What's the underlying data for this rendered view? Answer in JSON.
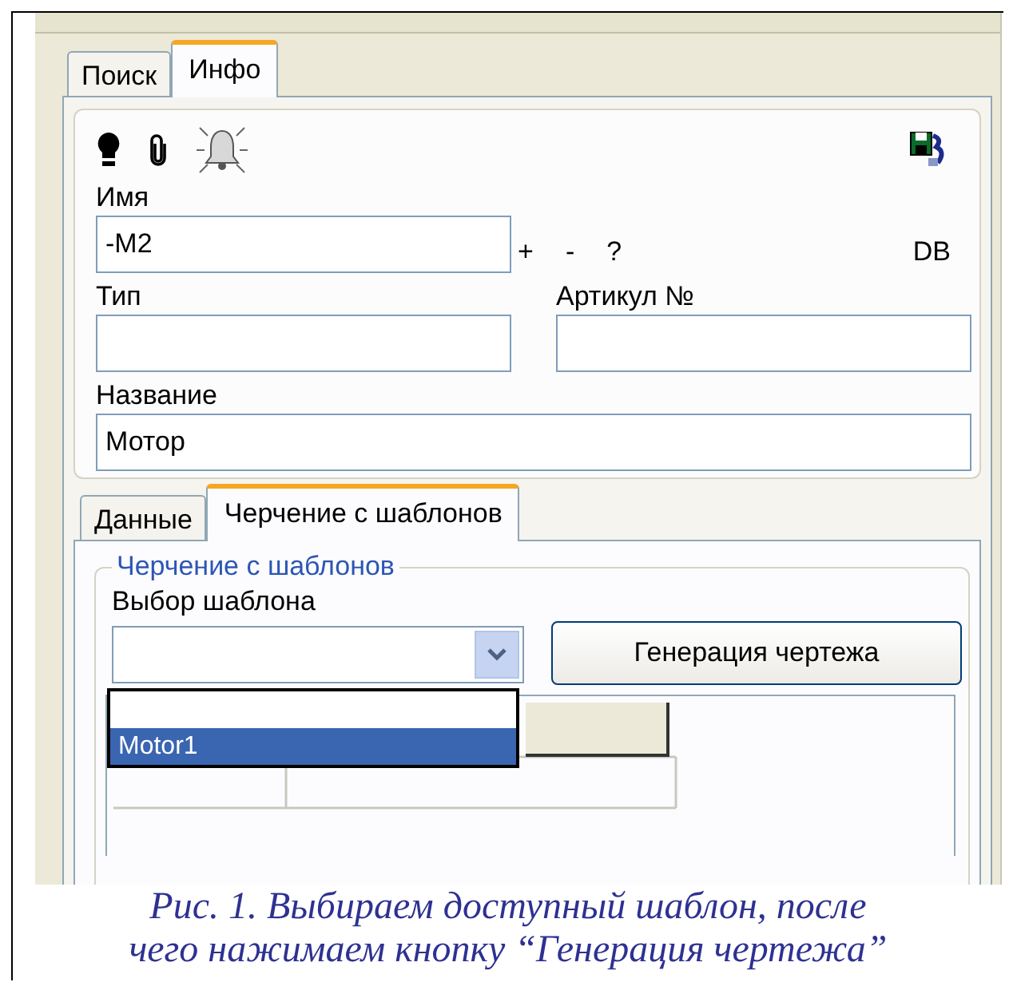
{
  "top_tabs": [
    {
      "label": "Поиск",
      "selected": false
    },
    {
      "label": "Инфо",
      "selected": true
    }
  ],
  "info": {
    "name_label": "Имя",
    "name_value": "-M2",
    "name_actions": [
      "+",
      "-",
      "?"
    ],
    "db_button": "DB",
    "type_label": "Тип",
    "article_label": "Артикул №",
    "title_label": "Название",
    "title_value": "Мотор"
  },
  "sub_tabs": [
    {
      "label": "Данные",
      "selected": false
    },
    {
      "label": "Черчение с шаблонов",
      "selected": true
    }
  ],
  "template_group": {
    "title": "Черчение с шаблонов",
    "select_label": "Выбор шаблона",
    "generate_button": "Генерация чертежа",
    "dropdown_blank_row": true,
    "dropdown": [
      {
        "label": "Motor1",
        "selected": true
      }
    ]
  },
  "caption": [
    "Рис. 1. Выбираем доступный шаблон, после",
    "чего нажимаем кнопку “Генерация чертежа”"
  ]
}
